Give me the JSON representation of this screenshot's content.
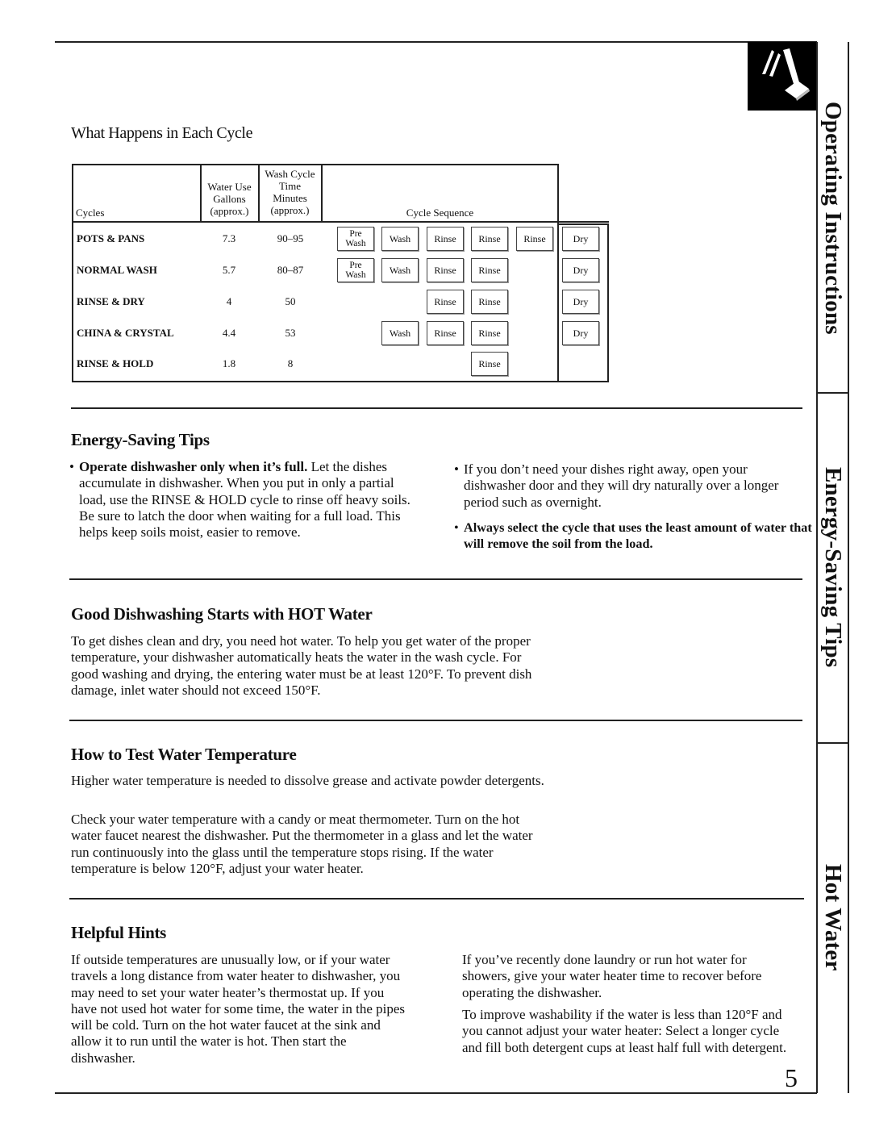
{
  "sidebar": {
    "tabs": [
      {
        "label": "Operating Instructions"
      },
      {
        "label": "Energy-Saving Tips"
      },
      {
        "label": "Hot Water"
      }
    ],
    "icon": "hand-pressing-button-icon"
  },
  "cycle_table": {
    "title": "What Happens in Each Cycle",
    "headers": {
      "cycles": "Cycles",
      "water_use": [
        "Water Use",
        "Gallons",
        "(approx.)"
      ],
      "time": [
        "Wash Cycle",
        "Time",
        "Minutes",
        "(approx.)"
      ],
      "sequence": "Cycle Sequence"
    },
    "rows": [
      {
        "cycle": "POTS & PANS",
        "gallons": "7.3",
        "minutes": "90–95",
        "sequence": [
          "Pre Wash",
          "Wash",
          "Rinse",
          "Rinse",
          "Rinse"
        ],
        "dry": "Dry"
      },
      {
        "cycle": "NORMAL WASH",
        "gallons": "5.7",
        "minutes": "80–87",
        "sequence": [
          "Pre Wash",
          "Wash",
          "Rinse",
          "Rinse",
          ""
        ],
        "dry": "Dry"
      },
      {
        "cycle": "RINSE & DRY",
        "gallons": "4",
        "minutes": "50",
        "sequence": [
          "",
          "",
          "Rinse",
          "Rinse",
          ""
        ],
        "dry": "Dry"
      },
      {
        "cycle": "CHINA & CRYSTAL",
        "gallons": "4.4",
        "minutes": "53",
        "sequence": [
          "",
          "Wash",
          "Rinse",
          "Rinse",
          ""
        ],
        "dry": "Dry"
      },
      {
        "cycle": "RINSE & HOLD",
        "gallons": "1.8",
        "minutes": "8",
        "sequence": [
          "",
          "",
          "",
          "Rinse",
          ""
        ],
        "dry": ""
      }
    ]
  },
  "energy_tips": {
    "heading": "Energy-Saving Tips",
    "bullets": [
      {
        "bold": "Operate dishwasher only when it’s full.",
        "text": " Let the dishes accumulate in dishwasher. When you put in only a partial load, use the RINSE & HOLD cycle to rinse off heavy soils. Be sure to latch the door when waiting for a full load. This helps keep soils moist, easier to remove."
      },
      {
        "bold": "",
        "text": "If you don’t need your dishes right away, open your dishwasher door and they will dry naturally over a longer period such as overnight."
      },
      {
        "bold": "Always select the cycle that uses the least amount of water that will remove the soil from the load.",
        "text": ""
      }
    ]
  },
  "hot_water": {
    "heading": "Good Dishwashing Starts with HOT Water",
    "body": "To get dishes clean and dry, you need hot water. To help you get water of the proper temperature, your dishwasher automatically heats the water in the wash cycle. For good washing and drying, the entering water must be at least 120°F. To prevent dish damage, inlet water should not exceed 150°F."
  },
  "test_temp": {
    "heading": "How to Test Water Temperature",
    "paragraphs": [
      "Higher water temperature is needed to dissolve grease and activate powder detergents.",
      "Check your water temperature with a candy or meat thermometer. Turn on the hot water faucet nearest the dishwasher. Put the thermometer in a glass and let the water run continuously into the glass until the temperature stops rising. If the water temperature is below 120°F, adjust your water heater."
    ]
  },
  "helpful_hints": {
    "heading": "Helpful Hints",
    "left": "If outside temperatures are unusually low, or if your water travels a long distance from water heater to dishwasher, you may need to set your water heater’s thermostat up. If you have not used hot water for some time, the water in the pipes will be cold. Turn on the hot water faucet at the sink and allow it to run until the water is hot. Then start the dishwasher.",
    "right": [
      "If you’ve recently done laundry or run hot water for showers, give your water heater time to recover before operating the dishwasher.",
      "To improve washability if the water is less than 120°F and you cannot adjust your water heater: Select a longer cycle and fill both detergent cups at least half full with detergent."
    ]
  },
  "page_number": "5"
}
